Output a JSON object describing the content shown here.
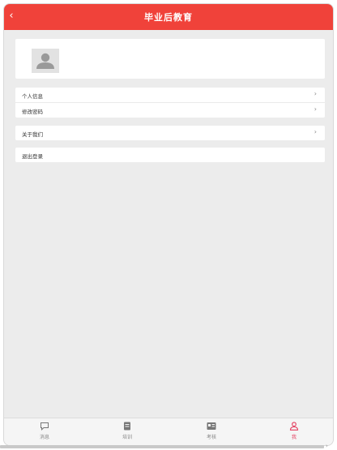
{
  "header": {
    "title": "毕业后教育",
    "back_glyph": "‹"
  },
  "profile": {
    "avatar_icon": "person-avatar-icon"
  },
  "menu_group_1": [
    {
      "label": "个人信息",
      "arrow": "›"
    },
    {
      "label": "修改密码",
      "arrow": "›"
    }
  ],
  "menu_group_2": [
    {
      "label": "关于我们",
      "arrow": "›"
    }
  ],
  "menu_group_3": [
    {
      "label": "退出登录"
    }
  ],
  "tabbar": {
    "tabs": [
      {
        "label": "消息",
        "icon": "chat-bubble-icon"
      },
      {
        "label": "培训",
        "icon": "document-icon"
      },
      {
        "label": "考核",
        "icon": "exam-card-icon"
      },
      {
        "label": "我",
        "icon": "person-icon",
        "active": true
      }
    ]
  },
  "colors": {
    "accent": "#f0423a",
    "active_tab": "#e33d5e",
    "background": "#ececec"
  }
}
